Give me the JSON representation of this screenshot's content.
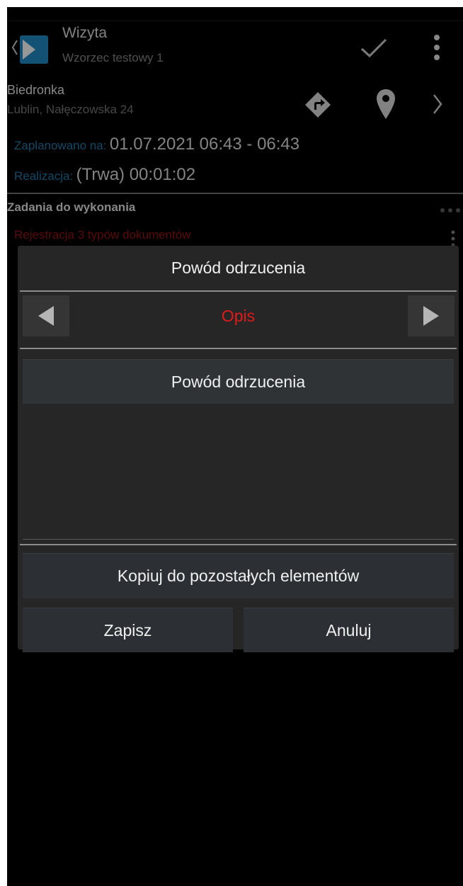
{
  "header": {
    "title": "Wizyta",
    "subtitle": "Wzorzec testowy 1"
  },
  "client": {
    "name": "Biedronka",
    "address": "Lublin, Nałęczowska 24"
  },
  "schedule": {
    "planned_label": "Zaplanowano na:",
    "planned_value": "01.07.2021 06:43 - 06:43",
    "realization_label": "Realizacja:",
    "realization_value": "(Trwa) 00:01:02"
  },
  "tasks": {
    "header": "Zadania do wykonania",
    "item": "Rejestracja 3 typów dokumentów"
  },
  "dialog": {
    "title": "Powód odrzucenia",
    "section_label": "Opis",
    "field_label": "Powód odrzucenia",
    "textarea_value": "",
    "copy_button": "Kopiuj do pozostałych elementów",
    "save_button": "Zapisz",
    "cancel_button": "Anuluj"
  },
  "colors": {
    "accent_link": "#1e6f9c",
    "section_label": "#e11b1b",
    "task_item": "#8b1010"
  },
  "icons": [
    "back-chevron-icon",
    "app-logo-icon",
    "checkmark-icon",
    "overflow-menu-icon",
    "directions-icon",
    "location-pin-icon",
    "chevron-right-icon",
    "prev-arrow-icon",
    "next-arrow-icon"
  ]
}
